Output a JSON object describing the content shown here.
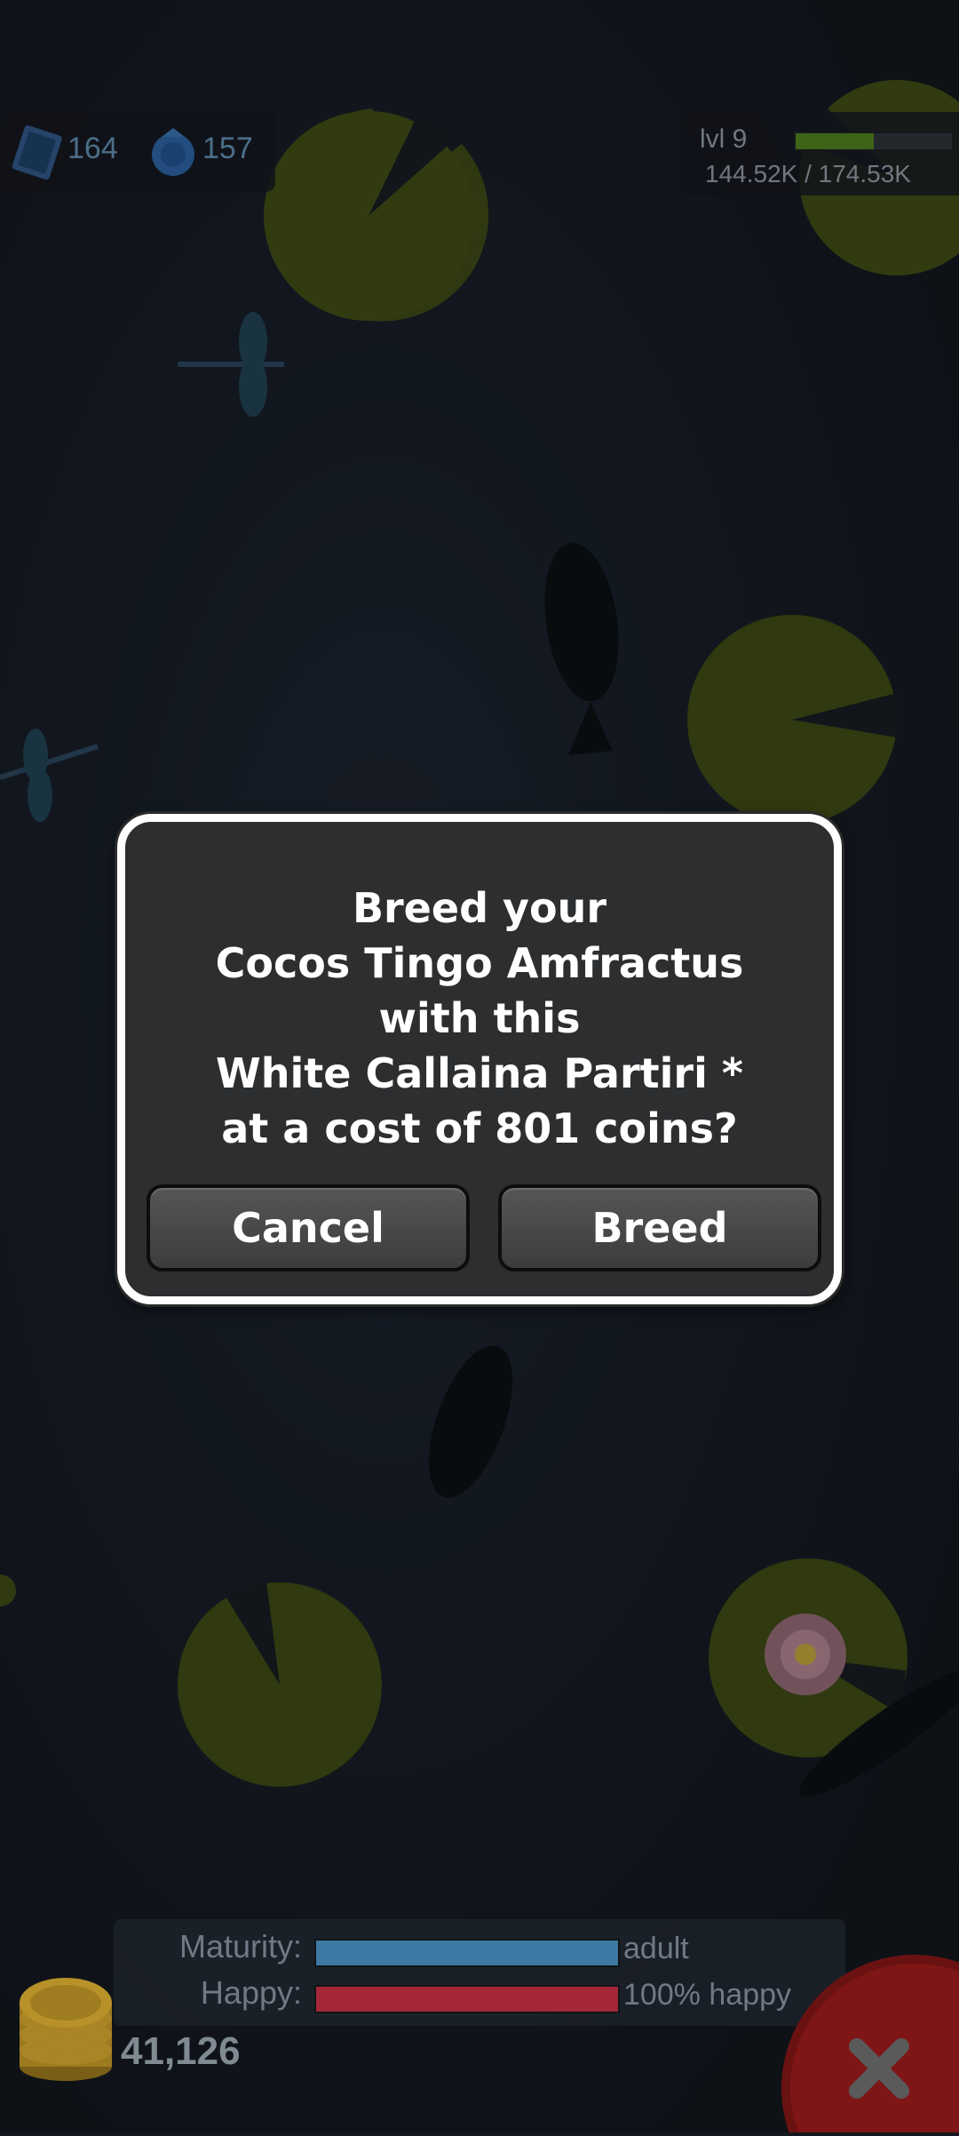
{
  "hud": {
    "stamps": "164",
    "pearls": "157",
    "level": "lvl 9",
    "xp_text": "144.52K / 174.53K",
    "xp_fraction": 0.5
  },
  "dialog": {
    "lines": [
      "Breed your",
      "Cocos Tingo Amfractus",
      "with this",
      "White Callaina Partiri *",
      "at a cost of 801 coins?"
    ],
    "cancel_label": "Cancel",
    "breed_label": "Breed"
  },
  "stats": {
    "maturity_label": "Maturity:",
    "maturity_value": "adult",
    "maturity_fraction": 1.0,
    "happy_label": "Happy:",
    "happy_value": "100% happy",
    "happy_fraction": 1.0
  },
  "coins": "41,126",
  "colors": {
    "maturity_bar": "#3e79a3",
    "happy_bar": "#a52637",
    "xp_bar": "#4e7a1e",
    "lily_pad": "#4f5e18",
    "close_button": "#8e1818"
  },
  "icons": {
    "stamp": "stamp-icon",
    "pearl": "pearl-icon",
    "coin": "coin-stack-icon",
    "close": "close-icon",
    "lotus": "lotus-flower-icon"
  }
}
